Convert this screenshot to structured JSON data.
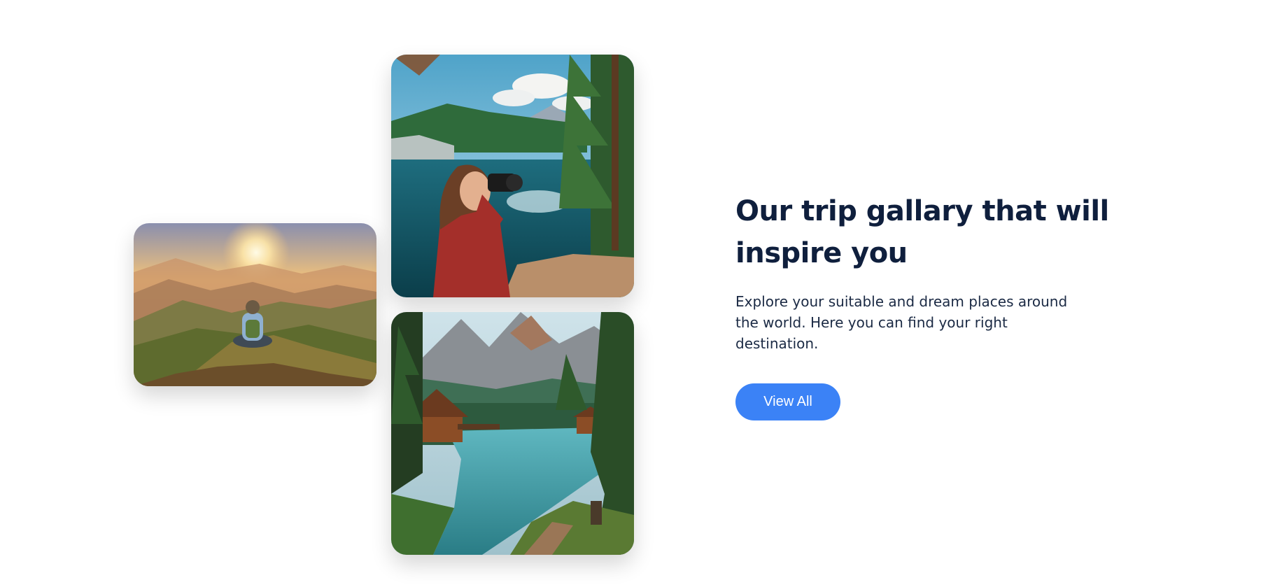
{
  "gallery": {
    "images": [
      {
        "alt": "Hiker sitting on a mountain ridge watching the sunset"
      },
      {
        "alt": "Photographer with camera beside a mountain lake"
      },
      {
        "alt": "Wooden cabin by a river in a forested mountain valley"
      }
    ]
  },
  "section": {
    "heading": "Our trip gallary that will inspire you",
    "description": "Explore your suitable and dream places around the world. Here you can find your right destination.",
    "button_label": "View All"
  },
  "colors": {
    "heading": "#0f1f3d",
    "text": "#1b2a44",
    "accent": "#3b82f6",
    "background": "#ffffff"
  },
  "icons": [
    "sunset-photo",
    "photographer-photo",
    "cabin-photo"
  ]
}
